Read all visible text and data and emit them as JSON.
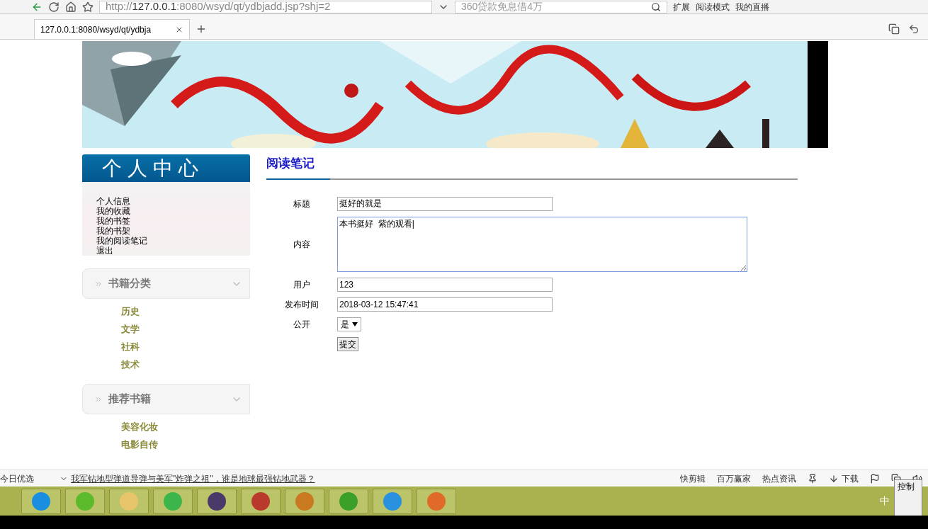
{
  "browser": {
    "address_scheme": "http://",
    "address_host": "127.0.0.1",
    "address_path": ":8080/wsyd/qt/ydbjadd.jsp?shj=2",
    "search_placeholder": "360贷款免息借4万",
    "toolbar_links": [
      "扩展",
      "阅读模式",
      "我的直播"
    ],
    "tab_title": "127.0.0.1:8080/wsyd/qt/ydbja"
  },
  "sidebar": {
    "header": "个人中心",
    "personal_links": [
      "个人信息",
      "我的收藏",
      "我的书签",
      "我的书架",
      "我的阅读笔记",
      "退出"
    ],
    "sections": [
      {
        "title": "书籍分类",
        "items": [
          "历史",
          "文学",
          "社科",
          "技术"
        ]
      },
      {
        "title": "推荐书籍",
        "items": [
          "美容化妆",
          "电影自传"
        ]
      }
    ]
  },
  "content": {
    "title": "阅读笔记",
    "form": [
      {
        "kind": "text",
        "label": "标题",
        "value": "挺好的就是"
      },
      {
        "kind": "textarea",
        "label": "内容",
        "value": "本书挺好  紫的观看|"
      },
      {
        "kind": "text",
        "label": "用户",
        "value": "123"
      },
      {
        "kind": "text",
        "label": "发布时间",
        "value": "2018-03-12 15:47:41"
      },
      {
        "kind": "select",
        "label": "公开",
        "value": "是"
      }
    ],
    "submit": "提交"
  },
  "status_bar": {
    "left": "今日优选",
    "news": "我军钻地型弹道导弹与美军\"炸弹之祖\"，谁是地球最强钻地武器？",
    "items": [
      "快剪辑",
      "百万赢家",
      "热点资讯"
    ],
    "download": "下载"
  },
  "taskbar": {
    "ime": "中",
    "popup": "控制"
  }
}
